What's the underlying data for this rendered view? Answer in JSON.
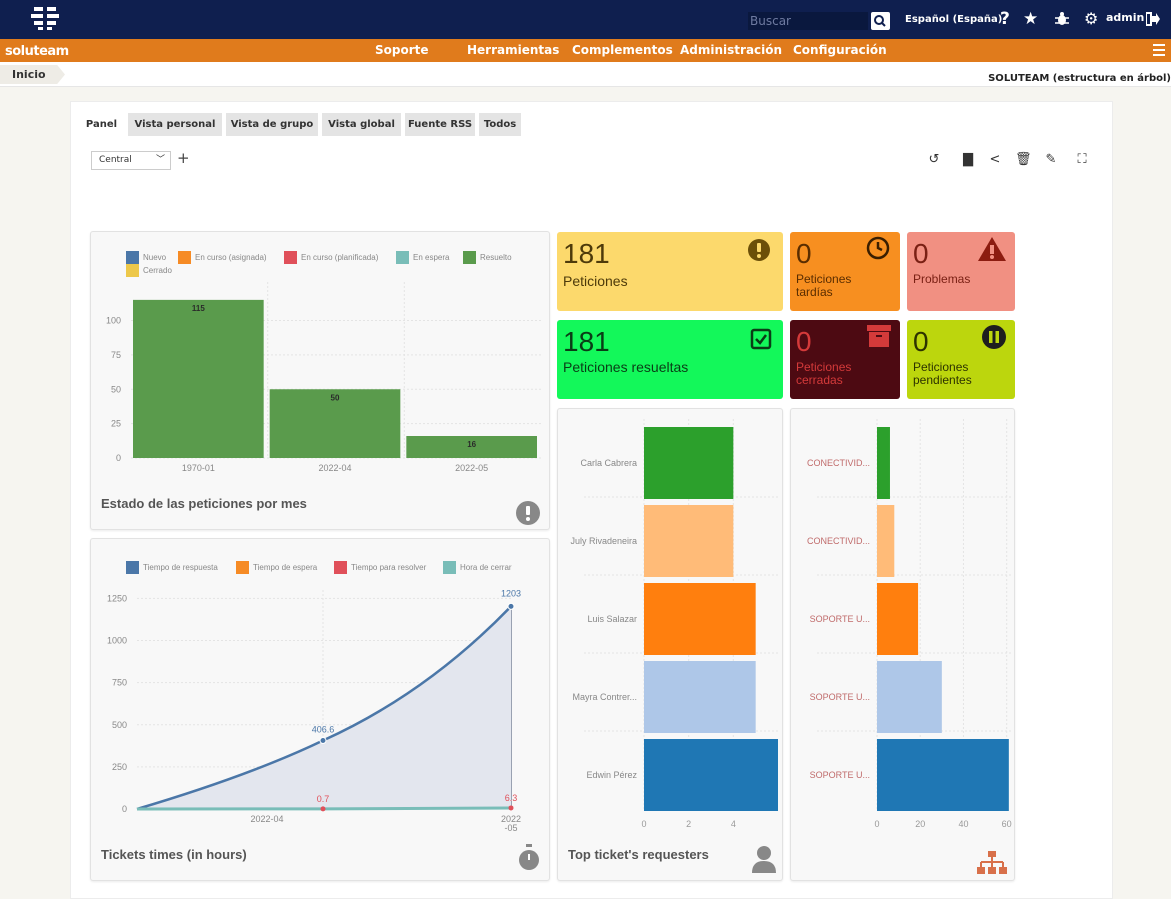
{
  "topbar": {
    "search_placeholder": "Buscar",
    "language": "Español (España)",
    "user": "admin",
    "icons": [
      "help-icon",
      "star-icon",
      "bug-icon",
      "gear-icon",
      "logout-icon"
    ]
  },
  "navbar": {
    "brand": "soluteam",
    "items": [
      "Soporte",
      "Herramientas",
      "Complementos",
      "Administración",
      "Configuración"
    ]
  },
  "breadcrumb": {
    "home": "Inicio",
    "entity": "SOLUTEAM (estructura en árbol)"
  },
  "tabs": [
    "Panel",
    "Vista personal",
    "Vista de grupo",
    "Vista global",
    "Fuente RSS",
    "Todos"
  ],
  "dashboard_select": "Central",
  "cards": {
    "peticiones": {
      "value": "181",
      "label": "Peticiones",
      "color": "#fcd96c"
    },
    "tardias": {
      "value": "0",
      "label": "Peticiones tardías",
      "color": "#f78f20"
    },
    "problemas": {
      "value": "0",
      "label": "Problemas",
      "color": "#f19082"
    },
    "resueltas": {
      "value": "181",
      "label": "Peticiones resueltas",
      "color": "#13f85a"
    },
    "cerradas": {
      "value": "0",
      "label": "Peticiones cerradas",
      "color": "#4d0a12"
    },
    "pendientes": {
      "value": "0",
      "label": "Peticiones pendientes",
      "color": "#bcd60d"
    }
  },
  "chart_data": [
    {
      "type": "bar",
      "title": "Estado de las peticiones por mes",
      "legend": [
        "Nuevo",
        "En curso (asignada)",
        "En curso (planificada)",
        "En espera",
        "Resuelto",
        "Cerrado"
      ],
      "legend_colors": [
        "#4b77a8",
        "#f68b25",
        "#e0505a",
        "#79bdb8",
        "#5a9b4c",
        "#edc84a"
      ],
      "categories": [
        "1970-01",
        "2022-04",
        "2022-05"
      ],
      "series": [
        {
          "name": "Resuelto",
          "values": [
            115,
            50,
            16
          ]
        }
      ],
      "y_ticks": [
        0,
        25,
        50,
        75,
        100
      ],
      "ylim": [
        0,
        128
      ]
    },
    {
      "type": "line",
      "title": "Tickets times (in hours)",
      "legend": [
        "Tiempo de respuesta",
        "Tiempo de espera",
        "Tiempo para resolver",
        "Hora de cerrar"
      ],
      "legend_colors": [
        "#4b77a8",
        "#f68b25",
        "#e0505a",
        "#79bdb8"
      ],
      "x": [
        "",
        "2022-04",
        "2022-05"
      ],
      "x_tick_labels": [
        "2022-04",
        "2022\n-05"
      ],
      "series": [
        {
          "name": "Tiempo de respuesta",
          "values": [
            0,
            406.6,
            1203
          ]
        },
        {
          "name": "Tiempo para resolver",
          "values": [
            0,
            0.7,
            6.3
          ]
        }
      ],
      "point_labels": [
        "406.6",
        "1203",
        "0.7",
        "6.3"
      ],
      "y_ticks": [
        0,
        250,
        500,
        750,
        1000,
        1250
      ],
      "ylim": [
        0,
        1300
      ]
    },
    {
      "type": "bar",
      "orientation": "horizontal",
      "title": "Top ticket's requesters",
      "categories": [
        "Carla Cabrera",
        "July Rivadeneira",
        "Luis Salazar",
        "Mayra Contrer...",
        "Edwin Pérez"
      ],
      "values": [
        4,
        4,
        5,
        5,
        6
      ],
      "colors": [
        "#2ca02c",
        "#ffbb78",
        "#ff7f0e",
        "#aec7e8",
        "#1f77b4"
      ],
      "x_ticks": [
        0,
        2,
        4
      ],
      "xlim": [
        0,
        6
      ]
    },
    {
      "type": "bar",
      "orientation": "horizontal",
      "title": "",
      "categories": [
        "CONECTIVID...",
        "CONECTIVID...",
        "SOPORTE U...",
        "SOPORTE U...",
        "SOPORTE U..."
      ],
      "values": [
        6,
        8,
        19,
        30,
        61
      ],
      "colors": [
        "#2ca02c",
        "#ffbb78",
        "#ff7f0e",
        "#aec7e8",
        "#1f77b4"
      ],
      "x_ticks": [
        0,
        20,
        40,
        60
      ],
      "xlim": [
        0,
        62
      ]
    }
  ]
}
